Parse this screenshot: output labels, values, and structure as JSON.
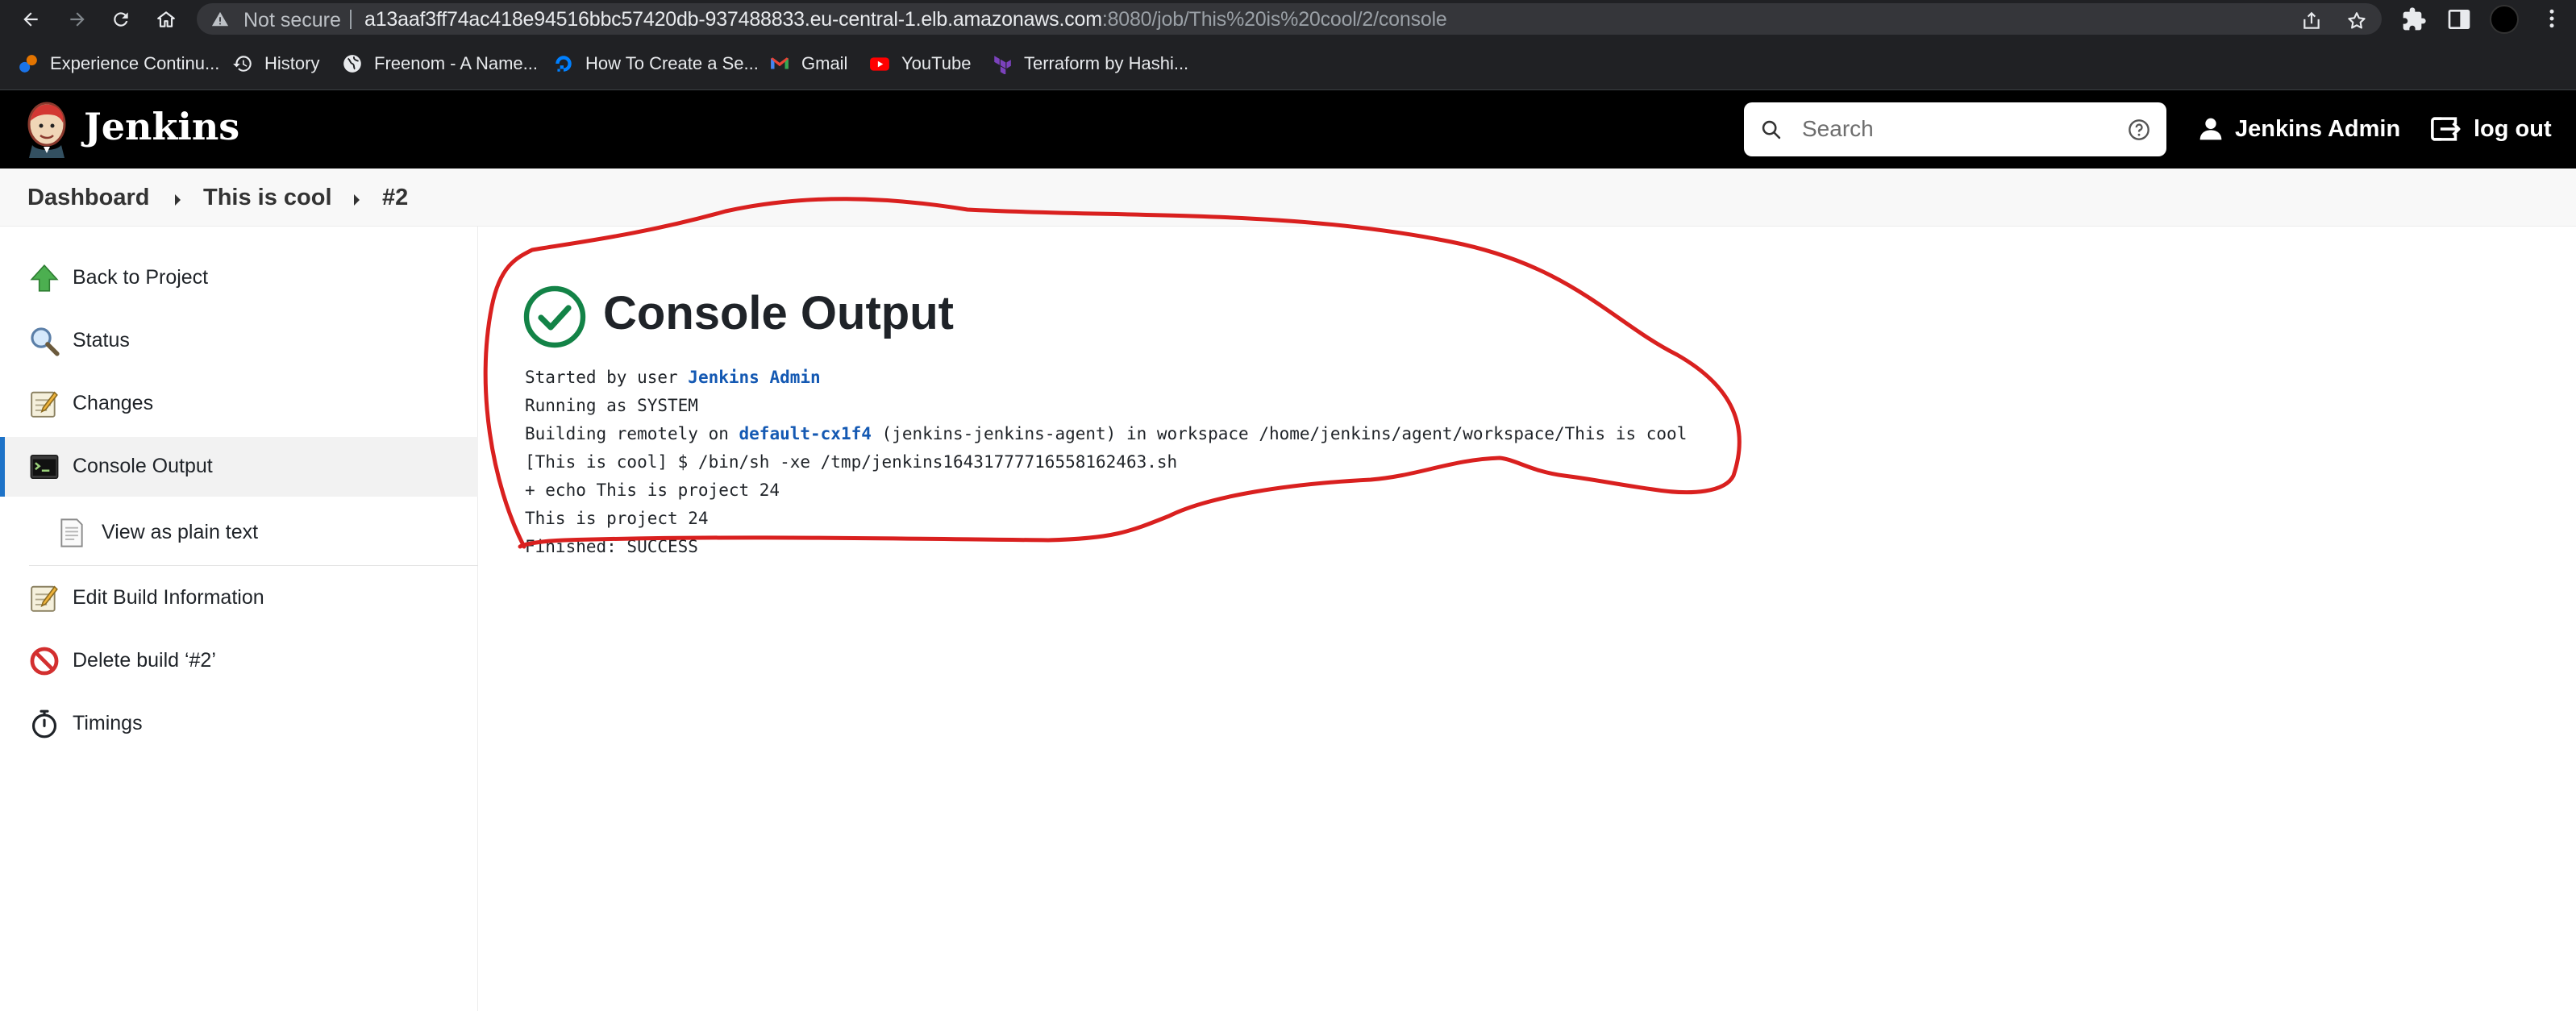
{
  "browser": {
    "not_secure_label": "Not secure",
    "url_host": "a13aaf3ff74ac418e94516bbc57420db-937488833.eu-central-1.elb.amazonaws.com",
    "url_path": ":8080/job/This%20is%20cool/2/console",
    "bookmarks": [
      {
        "label": "Experience Continu...",
        "icon": "experience-icon",
        "color": "#e37400"
      },
      {
        "label": "History",
        "icon": "history-icon",
        "color": "#e8eaed"
      },
      {
        "label": "Freenom - A Name...",
        "icon": "globe-icon",
        "color": "#e8eaed"
      },
      {
        "label": "How To Create a Se...",
        "icon": "digitalocean-icon",
        "color": "#0080ff"
      },
      {
        "label": "Gmail",
        "icon": "gmail-icon",
        "color": "#ea4335"
      },
      {
        "label": "YouTube",
        "icon": "youtube-icon",
        "color": "#ff0000"
      },
      {
        "label": "Terraform by Hashi...",
        "icon": "terraform-icon",
        "color": "#7b42bc"
      }
    ]
  },
  "header": {
    "title": "Jenkins",
    "search_placeholder": "Search",
    "user_name": "Jenkins Admin",
    "logout_label": "log out"
  },
  "breadcrumb": {
    "items": [
      "Dashboard",
      "This is cool",
      "#2"
    ]
  },
  "sidebar": {
    "items": [
      {
        "label": "Back to Project",
        "icon": "up-arrow-icon"
      },
      {
        "label": "Status",
        "icon": "magnifier-icon"
      },
      {
        "label": "Changes",
        "icon": "notepad-icon"
      },
      {
        "label": "Console Output",
        "icon": "terminal-icon",
        "active": true
      },
      {
        "label": "View as plain text",
        "icon": "document-icon",
        "sub": true
      },
      {
        "label": "Edit Build Information",
        "icon": "notepad-icon"
      },
      {
        "label": "Delete build ‘#2’",
        "icon": "no-entry-icon"
      },
      {
        "label": "Timings",
        "icon": "stopwatch-icon"
      }
    ]
  },
  "main": {
    "title": "Console Output",
    "console": {
      "line1_prefix": "Started by user ",
      "line1_link": "Jenkins Admin",
      "line2": "Running as SYSTEM",
      "line3_prefix": "Building remotely on ",
      "line3_link": "default-cx1f4",
      "line3_suffix": " (jenkins-jenkins-agent) in workspace /home/jenkins/agent/workspace/This is cool",
      "line4": "[This is cool] $ /bin/sh -xe /tmp/jenkins16431777716558162463.sh",
      "line5": "+ echo This is project 24",
      "line6": "This is project 24",
      "line7": "Finished: SUCCESS"
    }
  },
  "colors": {
    "success": "#138347",
    "link": "#1459b3",
    "active_bar": "#1e73c8",
    "annotation": "#d9201f"
  }
}
